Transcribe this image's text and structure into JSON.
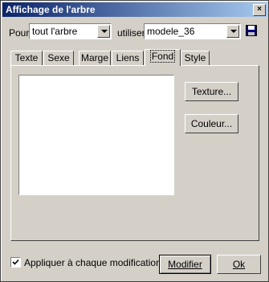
{
  "window": {
    "title": "Affichage de l'arbre",
    "close_glyph": "×"
  },
  "scope": {
    "label": "Pour",
    "value": "tout l'arbre"
  },
  "model": {
    "label": "utiliser",
    "value": "modele_36"
  },
  "tabs": [
    {
      "label": "Texte"
    },
    {
      "label": "Sexe"
    },
    {
      "label": "Marge"
    },
    {
      "label": "Liens"
    },
    {
      "label": "Fond",
      "active": true
    },
    {
      "label": "Style"
    }
  ],
  "fond": {
    "texture_button": "Texture...",
    "color_button": "Couleur..."
  },
  "footer": {
    "apply_checkbox_label": "Appliquer à chaque modification",
    "apply_checked": true,
    "modify_button": "Modifier",
    "ok_button": "Ok"
  },
  "colors": {
    "titlebar_start": "#0a246a",
    "titlebar_end": "#a6caf0",
    "face": "#d4d0c8"
  },
  "icons": {
    "save": "floppy-disk-icon"
  }
}
